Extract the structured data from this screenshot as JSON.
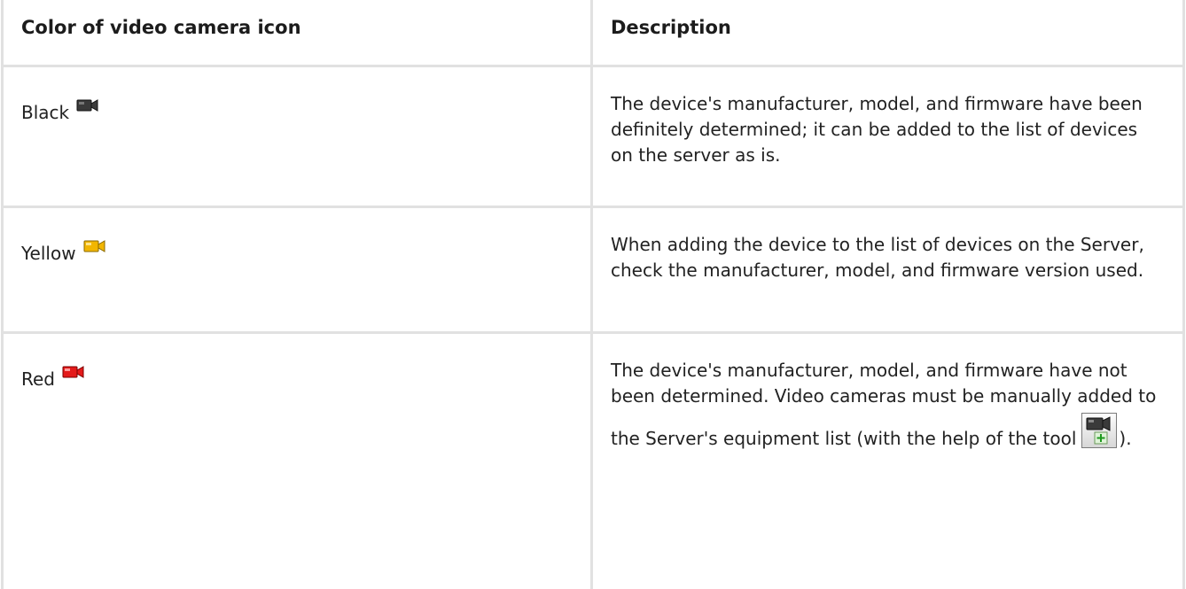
{
  "table": {
    "headers": {
      "color": "Color of video camera icon",
      "description": "Description"
    },
    "rows": [
      {
        "color_label": "Black",
        "icon": "video-camera-black-icon",
        "icon_color": "#333333",
        "description": "The device's manufacturer, model, and firmware have been definitely determined; it can be added to the list of devices on the server as is."
      },
      {
        "color_label": "Yellow",
        "icon": "video-camera-yellow-icon",
        "icon_color": "#f0b400",
        "description": "When adding the device to the list of devices on the Server, check the manufacturer, model, and firmware version used."
      },
      {
        "color_label": "Red",
        "icon": "video-camera-red-icon",
        "icon_color": "#e01010",
        "description_before_tool": "The device's manufacturer, model, and firmware have not been determined. Video cameras must be manually added to the Server's equipment list (with the help of the tool",
        "tool_icon": "add-camera-tool-icon",
        "description_after_tool": ")."
      }
    ]
  }
}
